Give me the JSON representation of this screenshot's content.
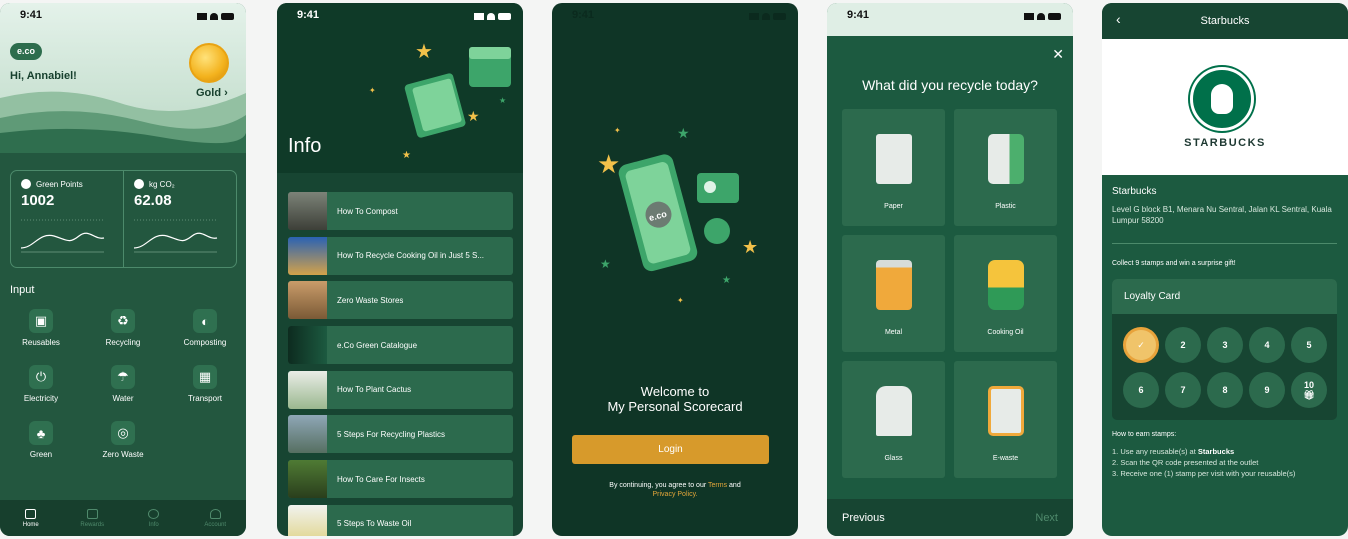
{
  "time": "9:41",
  "home": {
    "logo": "e.co",
    "greeting": "Hi, Annabiel!",
    "tier": "Gold ›",
    "stats": [
      {
        "label": "Green Points",
        "value": "1002"
      },
      {
        "label": "kg CO₂",
        "value": "62.08"
      }
    ],
    "section_title": "Input",
    "categories": [
      {
        "label": "Reusables",
        "icon": "bag-icon"
      },
      {
        "label": "Recycling",
        "icon": "recycle-bin-icon"
      },
      {
        "label": "Composting",
        "icon": "compost-icon"
      },
      {
        "label": "Electricity",
        "icon": "plug-icon"
      },
      {
        "label": "Water",
        "icon": "tap-icon"
      },
      {
        "label": "Transport",
        "icon": "bus-icon"
      },
      {
        "label": "Green",
        "icon": "plant-icon"
      },
      {
        "label": "Zero Waste",
        "icon": "zero-waste-icon"
      }
    ],
    "tabs": [
      "Home",
      "Rewards",
      "Info",
      "Account"
    ]
  },
  "info": {
    "title": "Info",
    "articles": [
      "How To Compost",
      "How To Recycle Cooking Oil in Just 5 S...",
      "Zero Waste Stores",
      "e.Co Green Catalogue",
      "How To Plant Cactus",
      "5 Steps For Recycling Plastics",
      "How To Care For Insects",
      "5 Steps To Waste Oil"
    ]
  },
  "login": {
    "welcome_line1": "Welcome to",
    "welcome_line2": "My Personal Scorecard",
    "button": "Login",
    "terms_prefix": "By continuing, you agree to our",
    "terms_link": "Terms",
    "terms_and": "and",
    "privacy_link": "Privacy Policy."
  },
  "recycle": {
    "question": "What did you recycle today?",
    "items": [
      "Paper",
      "Plastic",
      "Metal",
      "Cooking Oil",
      "Glass",
      "E-waste"
    ],
    "previous": "Previous",
    "next": "Next"
  },
  "store": {
    "header": "Starbucks",
    "brand_word": "STARBUCKS",
    "name": "Starbucks",
    "address": "Level G block B1, Menara Nu Sentral, Jalan KL Sentral, Kuala Lumpur 58200",
    "collect": "Collect 9 stamps and win a surprise gift!",
    "card_title": "Loyalty Card",
    "stamps": [
      "",
      "2",
      "3",
      "4",
      "5",
      "6",
      "7",
      "8",
      "9",
      "10"
    ],
    "how_title": "How to earn stamps:",
    "step1_prefix": "1.  Use any reusable(s) at",
    "step1_brand": "Starbucks",
    "step2": "2.  Scan the QR code presented at the outlet",
    "step3": "3.  Receive one (1) stamp per visit with your reusable(s)"
  }
}
